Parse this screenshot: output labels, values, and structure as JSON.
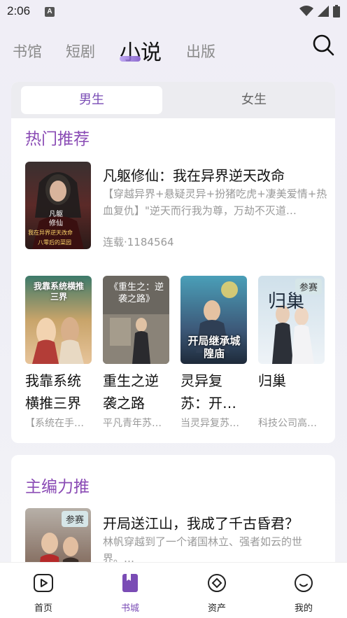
{
  "status": {
    "time": "2:06",
    "a_icon": "A"
  },
  "top_tabs": [
    "书馆",
    "短剧",
    "小说",
    "出版"
  ],
  "gender": {
    "male": "男生",
    "female": "女生"
  },
  "hot": {
    "title": "热门推荐",
    "featured": {
      "title": "凡躯修仙：我在异界逆天改命",
      "desc": "【穿越异界+悬疑灵异+扮猪吃虎+凄美爱情+热血复仇】\"逆天而行我为尊，万劫不灭道…",
      "meta": "连载·1184564",
      "cover_text_1": "凡躯",
      "cover_text_2": "修仙",
      "cover_text_3": "我在异界逆天改命",
      "cover_text_4": "八零后的菜园"
    },
    "books": [
      {
        "title": "我靠系统横推三界",
        "desc": "【系统在手…",
        "cover_text": "我靠系统横推三界"
      },
      {
        "title": "重生之逆袭之路",
        "desc": "平凡青年苏…",
        "cover_text": "《重生之：逆袭之路》"
      },
      {
        "title": "灵异复苏：开…",
        "desc": "当灵异复苏…",
        "cover_text": "开局继承城隍庙"
      },
      {
        "title": "归巢",
        "desc": "科技公司高…",
        "cover_text": "归巢",
        "badge": "参赛"
      }
    ]
  },
  "editor": {
    "title": "主编力推",
    "book": {
      "title": "开局送江山，我成了千古昏君？",
      "desc": "林帆穿越到了一个诸国林立、强者如云的世界。…",
      "badge": "参赛"
    }
  },
  "nav": [
    {
      "label": "首页",
      "icon": "play-icon"
    },
    {
      "label": "书城",
      "icon": "book-icon"
    },
    {
      "label": "资产",
      "icon": "coin-icon"
    },
    {
      "label": "我的",
      "icon": "smile-icon"
    }
  ],
  "colors": {
    "accent": "#7a4cb5",
    "section_title": "#8a4bb5"
  }
}
